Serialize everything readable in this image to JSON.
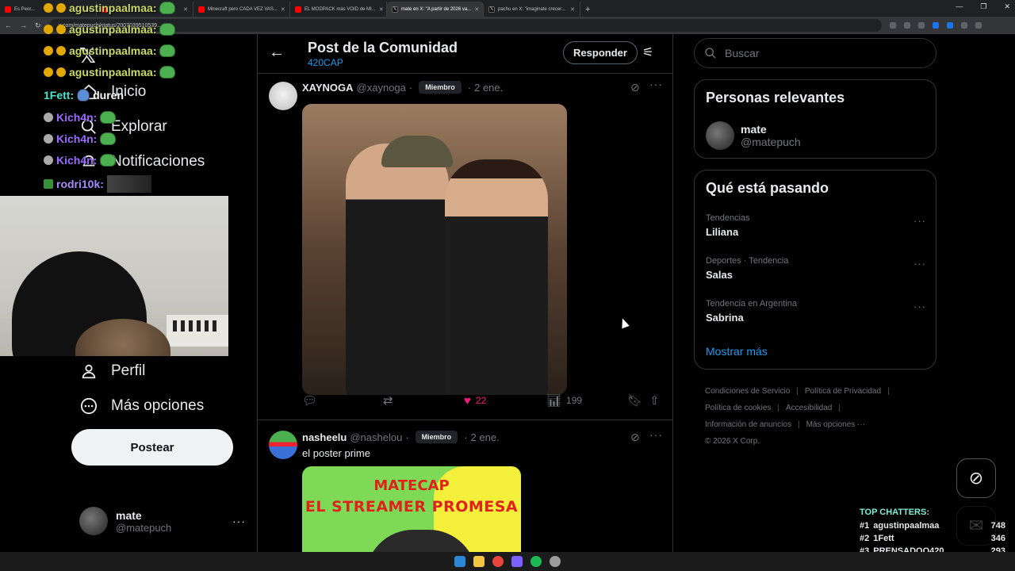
{
  "browser": {
    "tabs": [
      {
        "title": "Es Peor...",
        "icon": "youtube-icon"
      },
      {
        "title": "...",
        "icon": "youtube-icon"
      },
      {
        "title": "Minecraft pero CADA VEZ VAS...",
        "icon": "youtube-icon"
      },
      {
        "title": "EL MODPACK más VOID de MI...",
        "icon": "youtube-icon"
      },
      {
        "title": "mate en X: \"A partir de 2026 va...",
        "icon": "x-icon",
        "active": true
      },
      {
        "title": "pachu en X: \"imaginate crecer...",
        "icon": "x-icon"
      }
    ],
    "url": "x.com/matepuch/status/2007039510539...",
    "new_tab": "+"
  },
  "nav": {
    "items": [
      {
        "label": "Inicio",
        "icon": "home-icon"
      },
      {
        "label": "Explorar",
        "icon": "search-icon"
      },
      {
        "label": "Notificaciones",
        "icon": "bell-icon"
      },
      {
        "label": "Perfil",
        "icon": "person-icon"
      },
      {
        "label": "Más opciones",
        "icon": "more-circle-icon"
      }
    ],
    "post_button": "Postear",
    "account": {
      "name": "mate",
      "handle": "@matepuch"
    }
  },
  "chat": {
    "lines": [
      {
        "user": "agustinpaalmaa:",
        "color": "#c9d86a"
      },
      {
        "user": "agustinpaalmaa:",
        "color": "#c9d86a"
      },
      {
        "user": "agustinpaalmaa:",
        "color": "#c9d86a"
      },
      {
        "user": "agustinpaalmaa:",
        "color": "#c9d86a"
      },
      {
        "user": "1Fett:",
        "color": "#4fe0c8",
        "text": "duren"
      },
      {
        "user": "Kich4n:",
        "color": "#9b6bff"
      },
      {
        "user": "Kich4n:",
        "color": "#9b6bff"
      },
      {
        "user": "Kich4n:",
        "color": "#9b6bff"
      },
      {
        "user": "rodri10k:",
        "color": "#a78bfa"
      }
    ]
  },
  "header": {
    "title": "Post de la Comunidad",
    "community": "420CAP",
    "reply_button": "Responder"
  },
  "posts": [
    {
      "name": "XAYNOGA",
      "handle": "@xaynoga",
      "badge": "Miembro",
      "date": "2 ene.",
      "likes": "22",
      "views": "199"
    },
    {
      "name": "nasheelu",
      "handle": "@nashelou",
      "badge": "Miembro",
      "date": "2 ene.",
      "text": "el poster prime",
      "image_text_1": "MATECAP",
      "image_text_2": "EL STREAMER PROMESA"
    }
  ],
  "sidebar": {
    "search_placeholder": "Buscar",
    "relevant_title": "Personas relevantes",
    "relevant_person": {
      "name": "mate",
      "handle": "@matepuch"
    },
    "trends_title": "Qué está pasando",
    "trends": [
      {
        "category": "Tendencias",
        "name": "Liliana"
      },
      {
        "category": "Deportes · Tendencia",
        "name": "Salas"
      },
      {
        "category": "Tendencia en Argentina",
        "name": "Sabrina"
      }
    ],
    "show_more": "Mostrar más",
    "footer": [
      "Condiciones de Servicio",
      "Política de Privacidad",
      "Política de cookies",
      "Accesibilidad",
      "Información de anuncios",
      "Más opciones ···",
      "© 2026 X Corp."
    ]
  },
  "top_chatters": {
    "title": "TOP CHATTERS:",
    "rows": [
      {
        "rank": "#1",
        "user": "agustinpaalmaa",
        "count": "748"
      },
      {
        "rank": "#2",
        "user": "1Fett",
        "count": "346"
      },
      {
        "rank": "#3",
        "user": "PRENSADOO420",
        "count": "293"
      }
    ]
  },
  "colors": {
    "accent": "#1d9bf0",
    "like": "#f91880",
    "border": "#2f3336",
    "muted": "#71767b"
  }
}
